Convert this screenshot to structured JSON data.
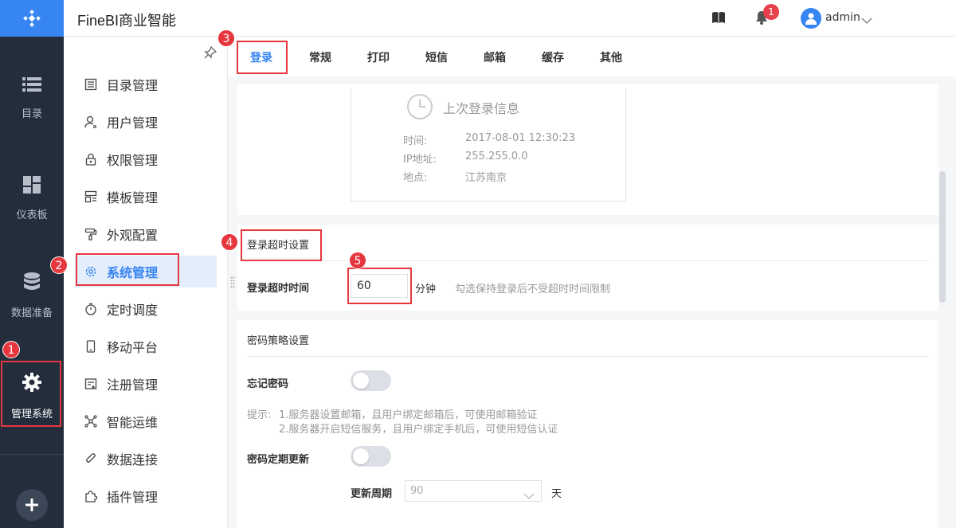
{
  "app": {
    "title": "FineBI商业智能"
  },
  "rail": {
    "items": [
      {
        "label": "目录"
      },
      {
        "label": "仪表板"
      },
      {
        "label": "数据准备"
      },
      {
        "label": "管理系统"
      }
    ]
  },
  "header": {
    "notification_count": "1",
    "user": "admin"
  },
  "menu": {
    "items": [
      {
        "label": "目录管理"
      },
      {
        "label": "用户管理"
      },
      {
        "label": "权限管理"
      },
      {
        "label": "模板管理"
      },
      {
        "label": "外观配置"
      },
      {
        "label": "系统管理"
      },
      {
        "label": "定时调度"
      },
      {
        "label": "移动平台"
      },
      {
        "label": "注册管理"
      },
      {
        "label": "智能运维"
      },
      {
        "label": "数据连接"
      },
      {
        "label": "插件管理"
      }
    ]
  },
  "tabs": [
    {
      "label": "登录"
    },
    {
      "label": "常规"
    },
    {
      "label": "打印"
    },
    {
      "label": "短信"
    },
    {
      "label": "邮箱"
    },
    {
      "label": "缓存"
    },
    {
      "label": "其他"
    }
  ],
  "last_login": {
    "title": "上次登录信息",
    "time_label": "时间:",
    "time_value": "2017-08-01 12:30:23",
    "ip_label": "IP地址:",
    "ip_value": "255.255.0.0",
    "location_label": "地点:",
    "location_value": "江苏南京"
  },
  "timeout": {
    "section_title": "登录超时设置",
    "label": "登录超时时间",
    "value": "60",
    "unit": "分钟",
    "hint": "勾选保持登录后不受超时时间限制"
  },
  "password": {
    "section_title": "密码策略设置",
    "forget_label": "忘记密码",
    "hint_prefix": "提示:",
    "hint_1": "1.服务器设置邮箱，且用户绑定邮箱后，可使用邮箱验证",
    "hint_2": "2.服务器开启短信服务，且用户绑定手机后，可使用短信认证",
    "periodic_label": "密码定期更新",
    "period_label": "更新周期",
    "period_value": "90",
    "period_unit": "天"
  },
  "annotations": [
    "1",
    "2",
    "3",
    "4",
    "5"
  ],
  "colors": {
    "accent": "#3685f2",
    "rail": "#232d3b",
    "highlight": "#e5373d"
  }
}
